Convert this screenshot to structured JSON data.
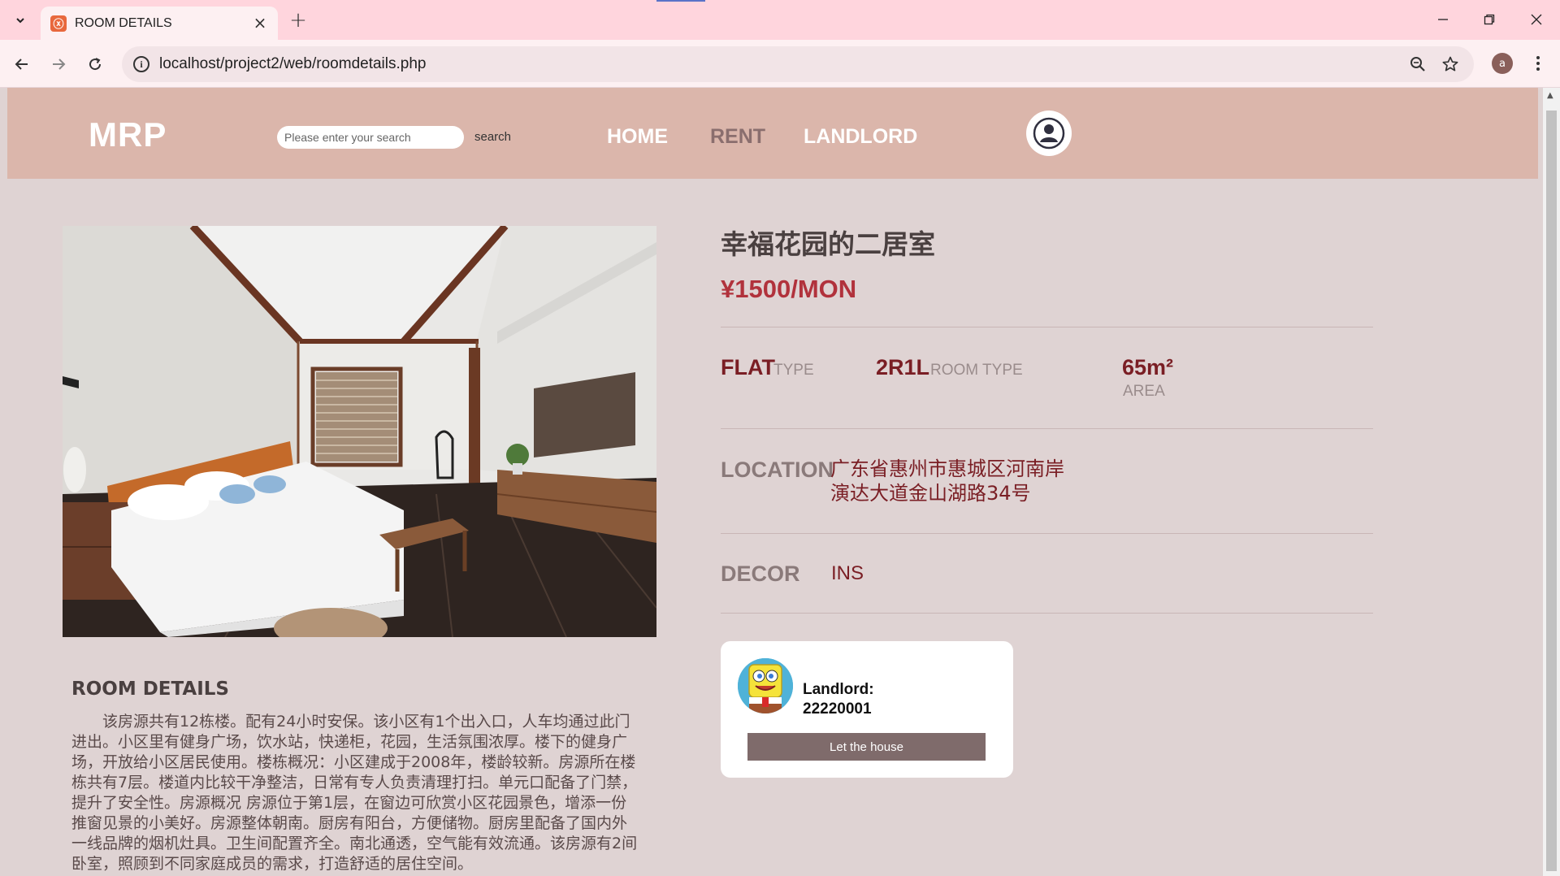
{
  "browser": {
    "tab_title": "ROOM DETAILS",
    "url": "localhost/project2/web/roomdetails.php",
    "profile_initial": "a"
  },
  "header": {
    "logo": "MRP",
    "search_placeholder": "Please enter your search",
    "search_button": "search",
    "nav": [
      {
        "label": "HOME",
        "color": "#ffffff"
      },
      {
        "label": "RENT",
        "color": "#8a6e6e"
      },
      {
        "label": "LANDLORD",
        "color": "#ffffff"
      }
    ]
  },
  "room": {
    "title": "幸福花园的二居室",
    "price": "¥1500/MON",
    "specs": [
      {
        "value": "FLAT",
        "label": "TYPE"
      },
      {
        "value": "2R1L",
        "label": "ROOM TYPE"
      },
      {
        "value": "65m²",
        "label": "AREA"
      }
    ],
    "location_label": "LOCATION",
    "location_line1": "广东省惠州市惠城区河南岸",
    "location_line2": "演达大道金山湖路34号",
    "decor_label": "DECOR",
    "decor_value": "INS"
  },
  "details": {
    "heading": "ROOM DETAILS",
    "body": "该房源共有12栋楼。配有24小时安保。该小区有1个出入口，人车均通过此门进出。小区里有健身广场，饮水站，快递柜，花园，生活氛围浓厚。楼下的健身广场，开放给小区居民使用。楼栋概况：小区建成于2008年，楼龄较新。房源所在楼栋共有7层。楼道内比较干净整洁，日常有专人负责清理打扫。单元口配备了门禁，提升了安全性。房源概况 房源位于第1层，在窗边可欣赏小区花园景色，增添一份推窗见景的小美好。房源整体朝南。厨房有阳台，方便储物。厨房里配备了国内外一线品牌的烟机灶具。卫生间配置齐全。南北通透，空气能有效流通。该房源有2间卧室，照顾到不同家庭成员的需求，打造舒适的居住空间。"
  },
  "landlord": {
    "label": "Landlord:",
    "id": "22220001",
    "button": "Let the house"
  }
}
